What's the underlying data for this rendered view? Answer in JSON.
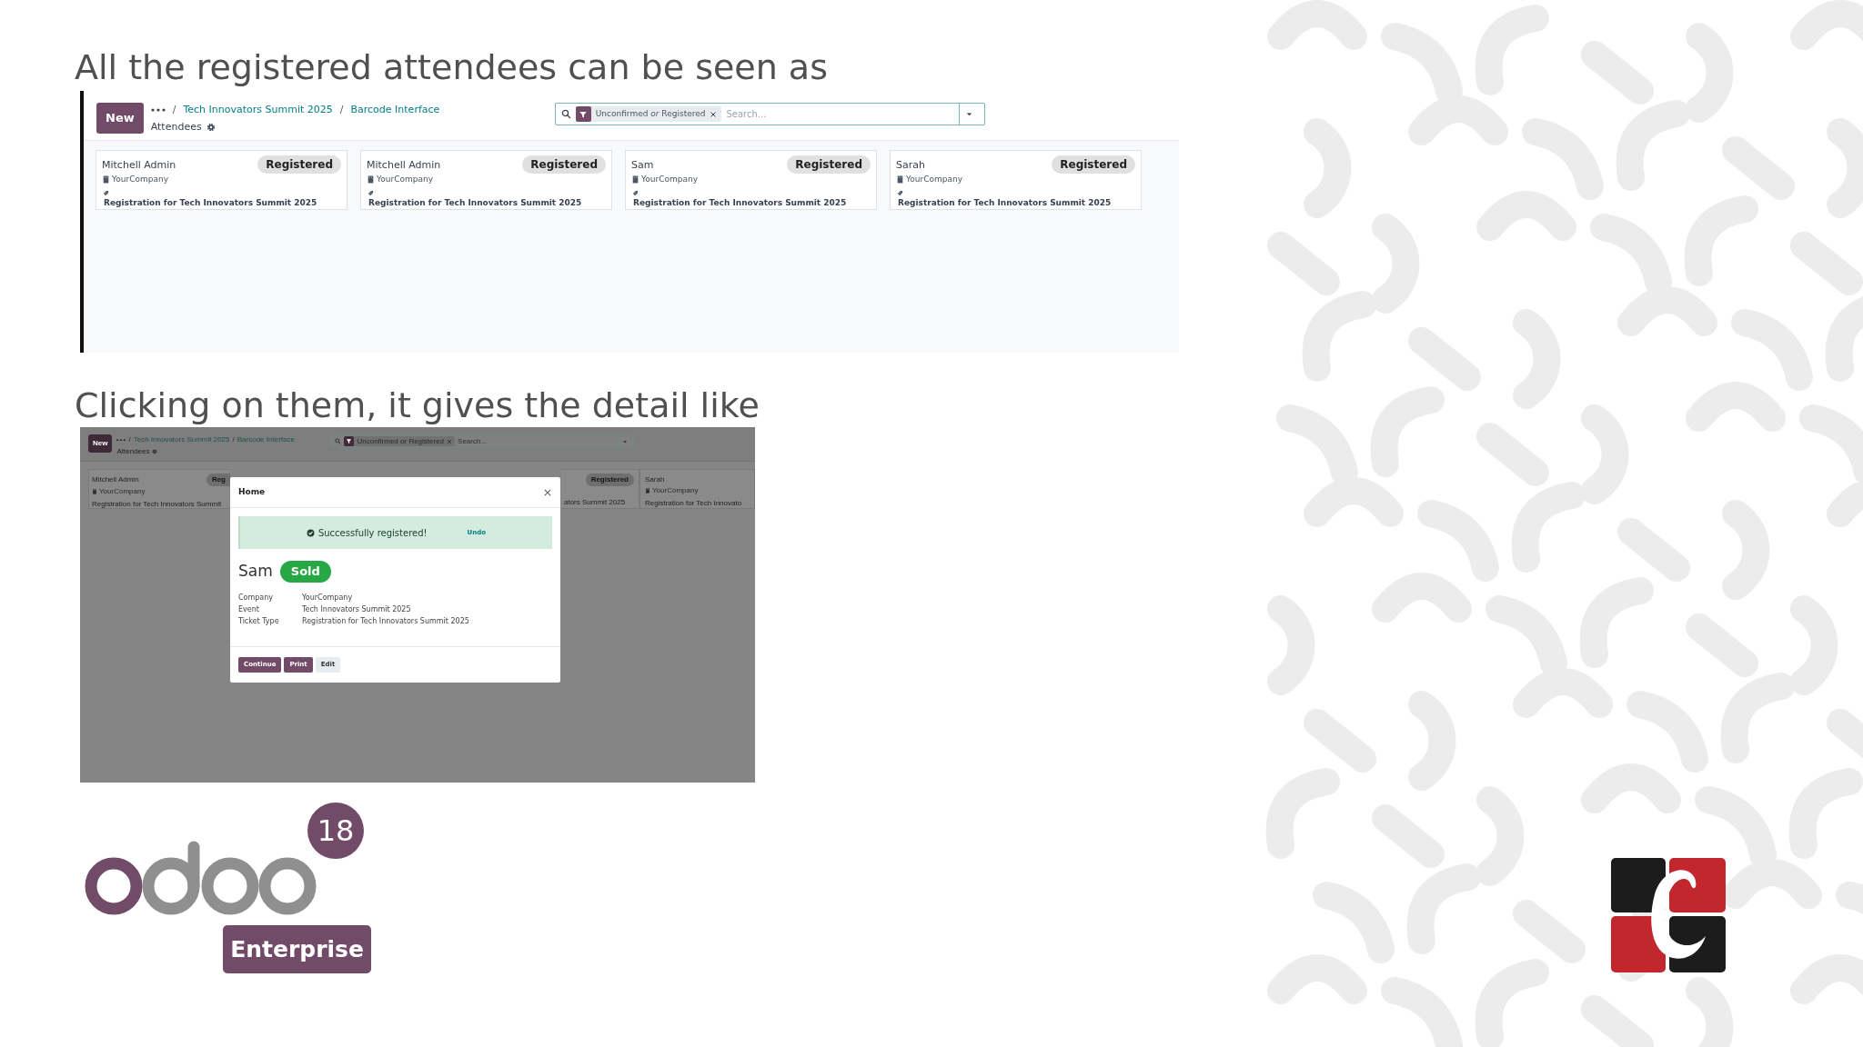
{
  "heading_1": "All the registered attendees can be seen as",
  "screenshot_1": {
    "new_button": "New",
    "breadcrumb": [
      {
        "separator": "/",
        "label": "Tech Innovators Summit 2025"
      },
      {
        "separator": "/",
        "label": "Barcode Interface"
      }
    ],
    "page_title": "Attendees",
    "filter": "Unconfirmed *or* Registered",
    "search": {
      "placeholder": "Search..."
    },
    "cards": [
      {
        "name": "Mitchell Admin",
        "company": "YourCompany",
        "status": "Registered",
        "ticket": "Registration for Tech Innovators Summit 2025"
      },
      {
        "name": "Mitchell Admin",
        "company": "YourCompany",
        "status": "Registered",
        "ticket": "Registration for Tech Innovators Summit 2025"
      },
      {
        "name": "Sam",
        "company": "YourCompany",
        "status": "Registered",
        "ticket": "Registration for Tech Innovators Summit 2025"
      },
      {
        "name": "Sarah",
        "company": "YourCompany",
        "status": "Registered",
        "ticket": "Registration for Tech Innovators Summit 2025"
      }
    ]
  },
  "heading_2": "Clicking on them, it gives the detail like",
  "screenshot_2": {
    "new_button": "New",
    "breadcrumb": [
      {
        "separator": "/",
        "label": "Tech Innovators Summit 2025"
      },
      {
        "separator": "/",
        "label": "Barcode Interface"
      }
    ],
    "page_title": "Attendees",
    "filter": "Unconfirmed *or* Registered",
    "search": {
      "placeholder": "Search..."
    },
    "cards": [
      {
        "name": "Mitchell Admin",
        "company": "YourCompany",
        "status": "Reg",
        "ticket": "Registration for Tech Innovators Summit"
      },
      {
        "status": "Registered",
        "ticket": "ators Summit 2025"
      },
      {
        "name": "Sarah",
        "company": "YourCompany",
        "ticket": "Registration for Tech Innovato"
      }
    ],
    "dialog": {
      "title": "Home",
      "notice": "Successfully registered!",
      "undo": "Undo",
      "attendee": "Sam",
      "badge": "Sold",
      "fields": [
        {
          "label": "Company",
          "value": "YourCompany"
        },
        {
          "label": "Event",
          "value": "Tech Innovators Summit 2025"
        },
        {
          "label": "Ticket Type",
          "value": "Registration for Tech Innovators Summit 2025"
        }
      ],
      "buttons": [
        {
          "label": "Continue",
          "kind": "primary"
        },
        {
          "label": "Print",
          "kind": "primary"
        },
        {
          "label": "Edit",
          "kind": "secondary"
        }
      ]
    }
  },
  "brand": {
    "version": "18",
    "edition": "Enterprise"
  }
}
